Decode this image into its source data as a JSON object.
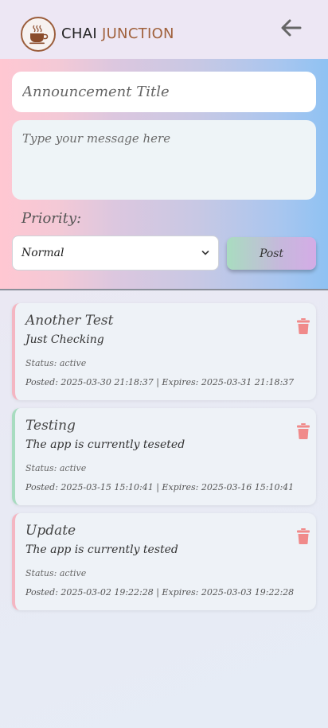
{
  "header": {
    "brand_part1": "CHAI",
    "brand_part2": "JUNCTION",
    "logo_icon": "coffee-cup-icon",
    "back_icon": "arrow-left-icon"
  },
  "compose": {
    "title_placeholder": "Announcement Title",
    "message_placeholder": "Type your message here",
    "priority_label": "Priority:",
    "priority_value": "Normal",
    "post_label": "Post"
  },
  "announcements": [
    {
      "title": "Another Test",
      "message": "Just Checking",
      "status": "Status: active",
      "dates": "Posted: 2025-03-30 21:18:37 | Expires: 2025-03-31 21:18:37",
      "accent": "#f4b6c2"
    },
    {
      "title": "Testing",
      "message": "The app is currently teseted",
      "status": "Status: active",
      "dates": "Posted: 2025-03-15 15:10:41 | Expires: 2025-03-16 15:10:41",
      "accent": "#a8dcc0"
    },
    {
      "title": "Update",
      "message": "The app is currently tested",
      "status": "Status: active",
      "dates": "Posted: 2025-03-02 19:22:28 | Expires: 2025-03-03 19:22:28",
      "accent": "#f4b6c2"
    }
  ],
  "colors": {
    "brand_brown": "#a0613c",
    "delete_icon": "#f08a8a"
  }
}
